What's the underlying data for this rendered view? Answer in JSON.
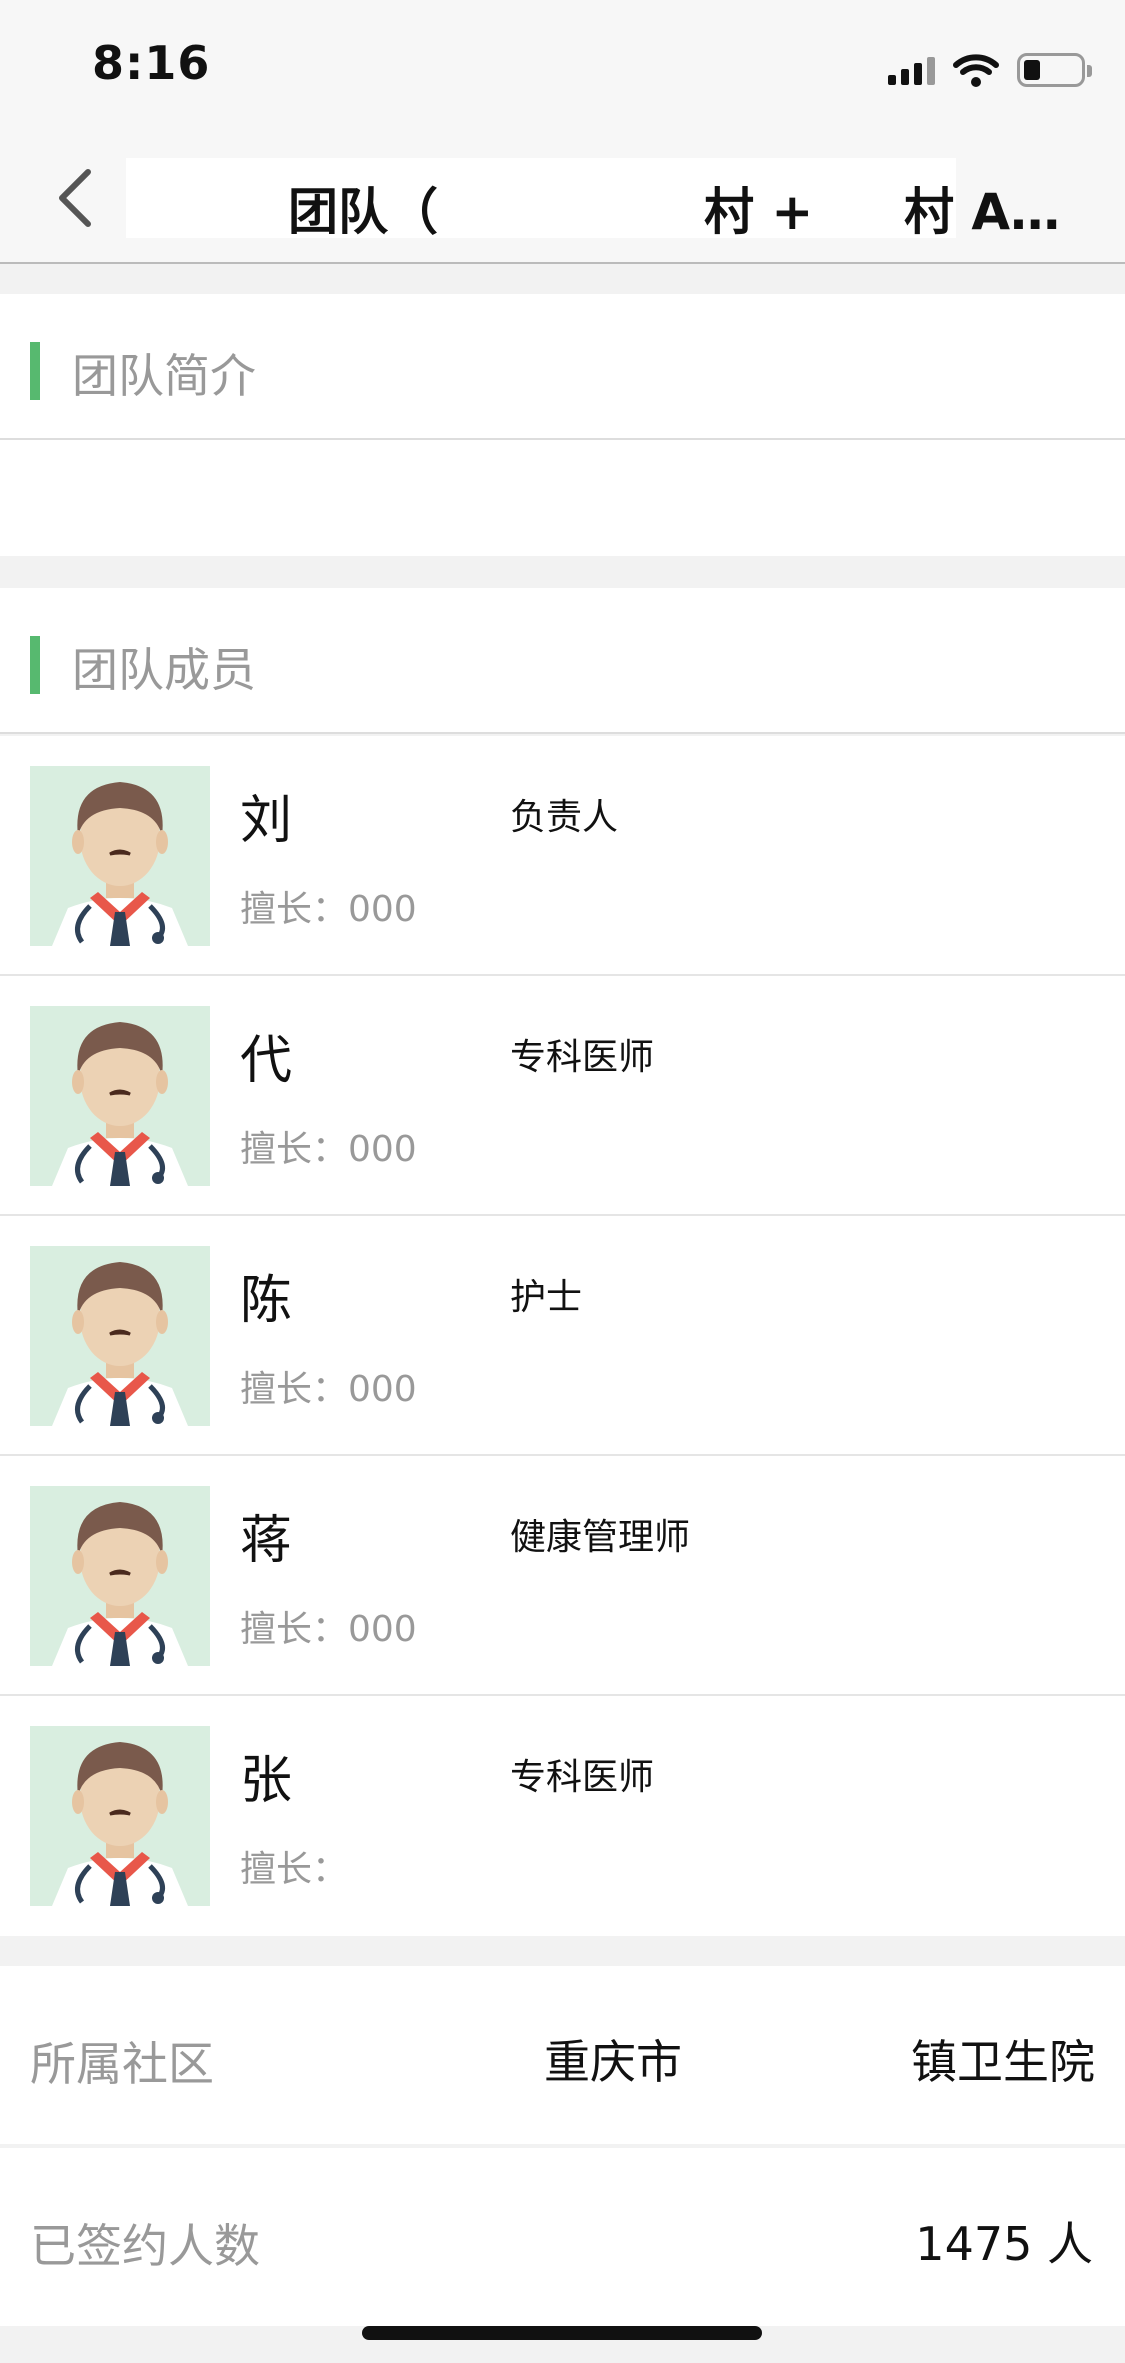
{
  "status_bar": {
    "time": "8:16",
    "icons": [
      "signal-icon",
      "wifi-icon",
      "battery-icon"
    ]
  },
  "nav": {
    "title_parts": [
      "团队（",
      "村 +",
      "村 A…"
    ],
    "back_icon": "chevron-left-icon"
  },
  "intro": {
    "title": "团队简介",
    "body": ""
  },
  "members_section": {
    "title": "团队成员",
    "members": [
      {
        "name": "刘",
        "role": "负责人",
        "skill": "擅长：000"
      },
      {
        "name": "代",
        "role": "专科医师",
        "skill": "擅长：000"
      },
      {
        "name": "陈",
        "role": "护士",
        "skill": "擅长：000"
      },
      {
        "name": "蒋",
        "role": "健康管理师",
        "skill": "擅长：000"
      },
      {
        "name": "张",
        "role": "专科医师",
        "skill": "擅长："
      }
    ]
  },
  "community": {
    "label": "所属社区",
    "value_left": "重庆市",
    "value_right": "镇卫生院"
  },
  "signed": {
    "label": "已签约人数",
    "value": "1475 人"
  },
  "colors": {
    "accent": "#57b96f",
    "avatar_bg": "#d9eee0"
  }
}
